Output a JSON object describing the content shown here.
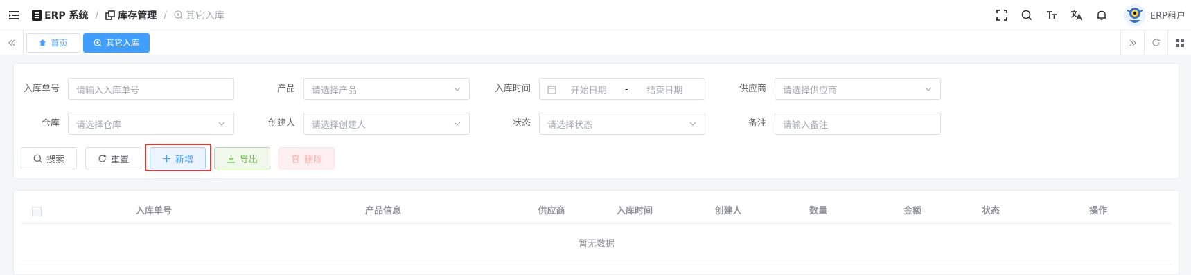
{
  "header": {
    "breadcrumb": {
      "system": "ERP 系统",
      "module": "库存管理",
      "page": "其它入库",
      "separator": "/"
    },
    "user": {
      "name": "ERP租户"
    }
  },
  "tags": {
    "home": "首页",
    "active": "其它入库"
  },
  "search_form": {
    "fields": [
      {
        "label": "入库单号",
        "placeholder": "请输入入库单号",
        "type": "input"
      },
      {
        "label": "产品",
        "placeholder": "请选择产品",
        "type": "select"
      },
      {
        "label": "入库时间",
        "start_placeholder": "开始日期",
        "range_separator": "-",
        "end_placeholder": "结束日期",
        "type": "daterange"
      },
      {
        "label": "供应商",
        "placeholder": "请选择供应商",
        "type": "select"
      },
      {
        "label": "仓库",
        "placeholder": "请选择仓库",
        "type": "select"
      },
      {
        "label": "创建人",
        "placeholder": "请选择创建人",
        "type": "select"
      },
      {
        "label": "状态",
        "placeholder": "请选择状态",
        "type": "select"
      },
      {
        "label": "备注",
        "placeholder": "请输入备注",
        "type": "input"
      }
    ],
    "buttons": {
      "search": "搜索",
      "reset": "重置",
      "add": "新增",
      "export": "导出",
      "delete": "删除"
    }
  },
  "table": {
    "columns": [
      "入库单号",
      "产品信息",
      "供应商",
      "入库时间",
      "创建人",
      "数量",
      "金额",
      "状态",
      "操作"
    ],
    "empty_text": "暂无数据"
  },
  "colors": {
    "primary": "#409eff",
    "success": "#67c23a",
    "danger": "#f56c6c",
    "highlight": "#e53935"
  }
}
